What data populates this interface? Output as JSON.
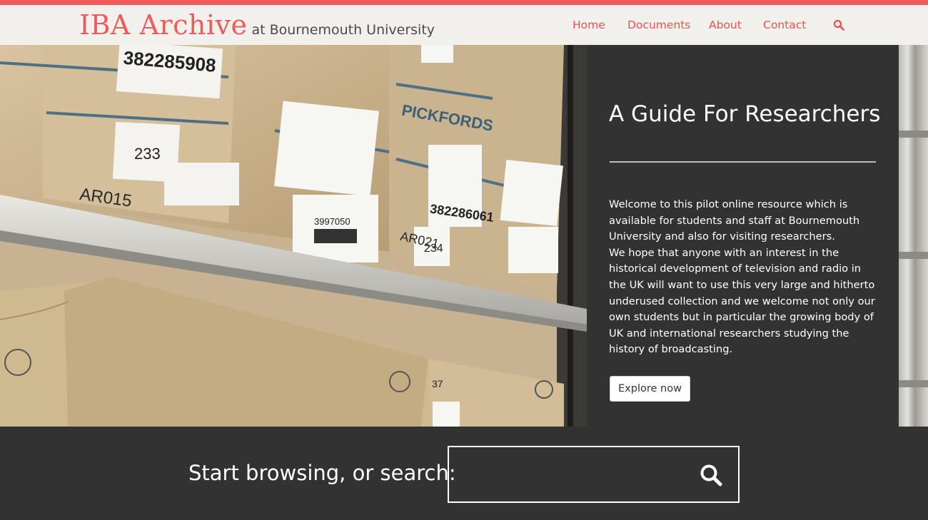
{
  "brand": {
    "title": "IBA Archive",
    "subtitle": "at Bournemouth University"
  },
  "nav": {
    "items": [
      "Home",
      "Documents",
      "About",
      "Contact"
    ],
    "search_icon": "search-icon"
  },
  "hero": {
    "photo_labels": {
      "box1": "382285908",
      "box2": "233",
      "box3": "AR015",
      "box4": "3997050",
      "box5": "382286061",
      "box6": "234",
      "box7": "AR021",
      "box8": "PICKFORDS",
      "box9": "37"
    },
    "title": "A Guide For Researchers",
    "body": "Welcome to this pilot online resource which is available for students and staff at Bournemouth University and also for visiting researchers.\nWe hope that anyone with an interest in the historical development of television and radio in the UK will want to use this very large and hitherto underused collection and we welcome not only our own students but in particular the growing body of UK and international researchers studying the history of broadcasting.",
    "button": "Explore now"
  },
  "search": {
    "label": "Start browsing, or search:",
    "value": "",
    "icon": "search-icon"
  },
  "colors": {
    "accent": "#f05a5a",
    "header_bg": "#f1f0ed",
    "dark_bg": "#323232"
  }
}
